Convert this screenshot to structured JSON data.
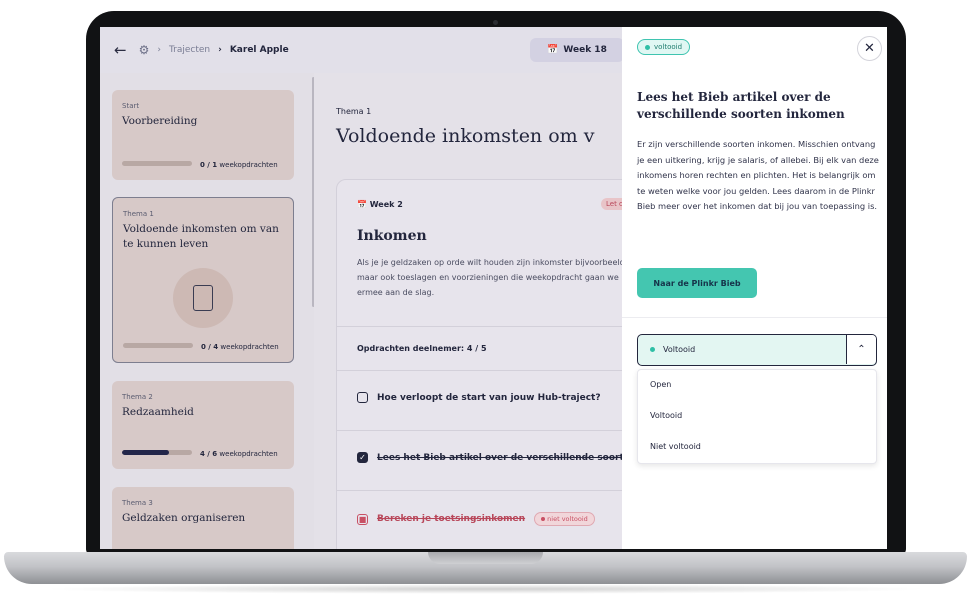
{
  "breadcrumb": {
    "items": [
      "Trajecten",
      "Karel Apple"
    ]
  },
  "header": {
    "week_label": "Week 18"
  },
  "sidebar": {
    "cards": [
      {
        "subtitle": "Start",
        "title": "Voorbereiding",
        "progress_count": "0 / 1",
        "progress_unit": "weekopdrachten",
        "progress": 0.0
      },
      {
        "subtitle": "Thema 1",
        "title": "Voldoende inkomsten om van te kunnen leven",
        "progress_count": "0 / 4",
        "progress_unit": "weekopdrachten",
        "progress": 0.0
      },
      {
        "subtitle": "Thema 2",
        "title": "Redzaamheid",
        "progress_count": "4 / 6",
        "progress_unit": "weekopdrachten",
        "progress": 0.67
      },
      {
        "subtitle": "Thema 3",
        "title": "Geldzaken organiseren"
      }
    ]
  },
  "main": {
    "thema_label": "Thema 1",
    "thema_title": "Voldoende inkomsten om v",
    "week_card": {
      "week_label": "Week 2",
      "badge": "Let o",
      "title": "Inkomen",
      "description": "Als je je geldzaken op orde wilt houden zijn inkomster bijvoorbeeld, maar ook toeslagen en voorzieningen die weekopdracht gaan we ermee aan de slag.",
      "opdrachten_label": "Opdrachten deelnemer: 4 / 5",
      "tasks": [
        {
          "label": "Hoe verloopt de start van jouw Hub-traject?"
        },
        {
          "label": "Lees het Bieb artikel over de verschillende soort"
        },
        {
          "label": "Bereken je toetsingsinkomen",
          "badge": "niet voltooid"
        }
      ]
    }
  },
  "panel": {
    "status_pill": "voltooid",
    "title": "Lees het Bieb artikel over de verschillende soorten inkomen",
    "description": "Er zijn verschillende soorten inkomen. Misschien ontvang je een uitkering, krijg je salaris, of allebei. Bij elk van deze inkomens horen rechten en plichten. Het is belangrijk om te weten welke voor jou gelden. Lees daarom in de Plinkr Bieb meer over het inkomen dat bij jou van toepassing is.",
    "button_label": "Naar de Plinkr Bieb",
    "status_select": {
      "selected": "Voltooid",
      "options": [
        "Open",
        "Voltooid",
        "Niet voltooid"
      ]
    }
  },
  "colors": {
    "accent_teal": "#44c6b0",
    "navy": "#23263d",
    "danger": "#c85064"
  }
}
